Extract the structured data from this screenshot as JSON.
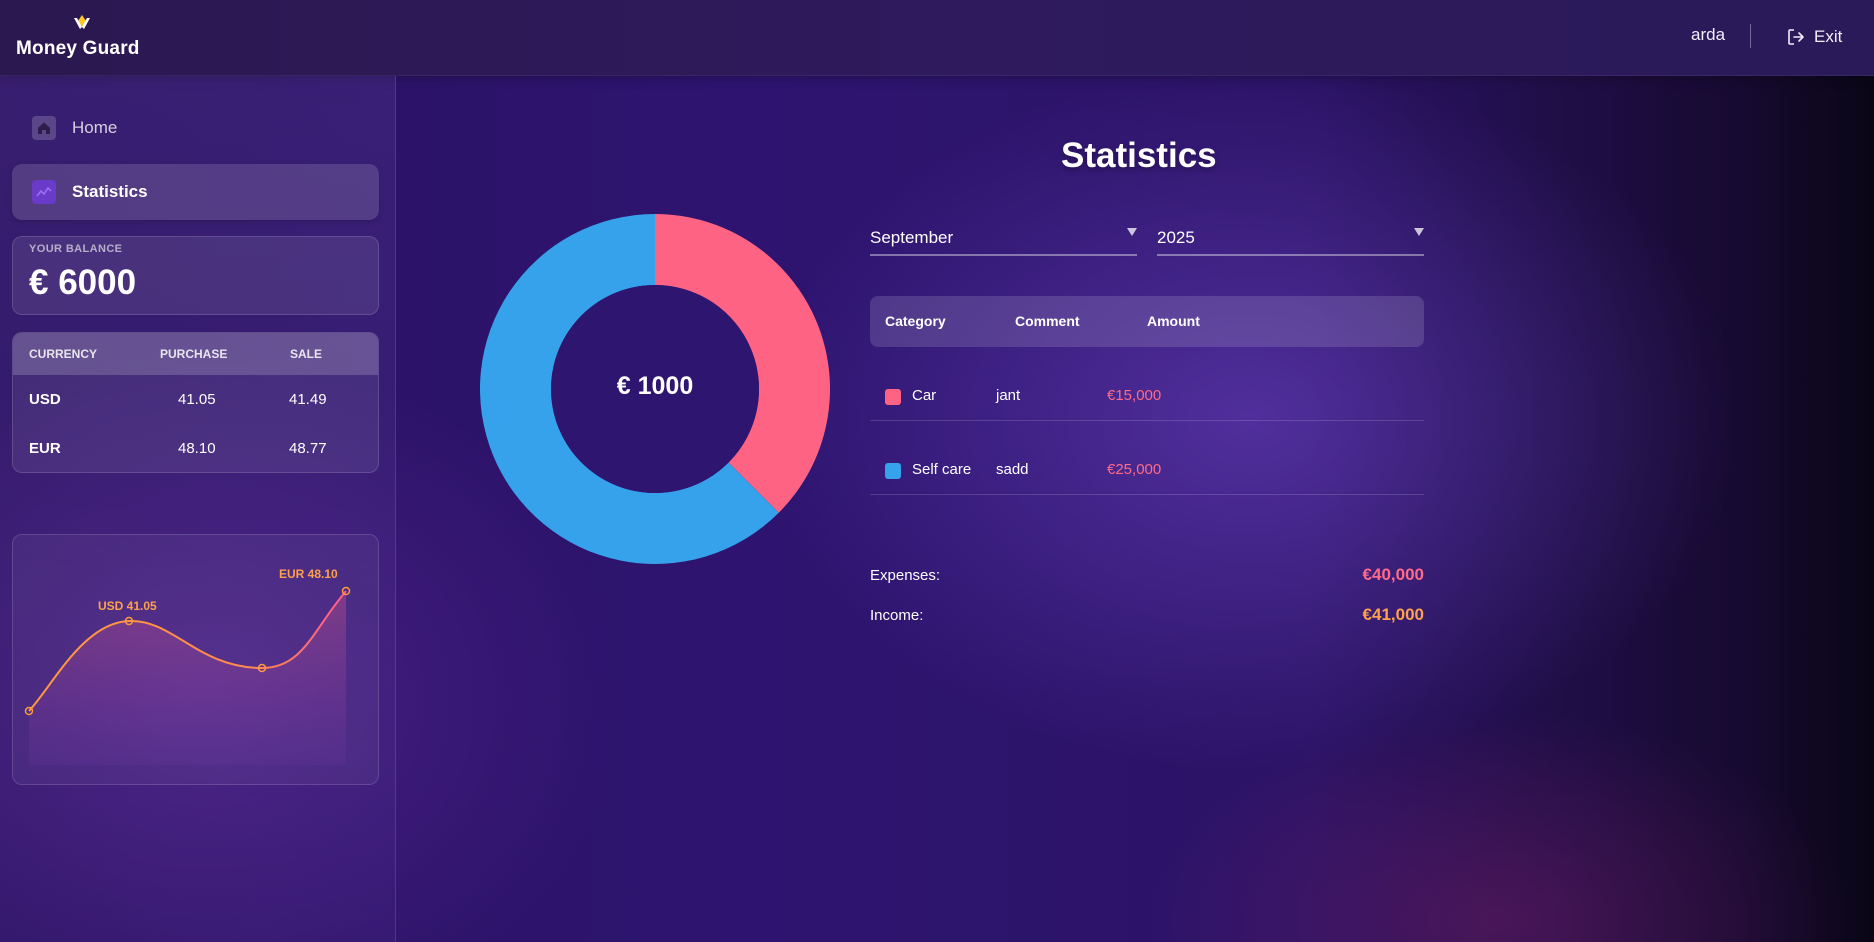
{
  "header": {
    "logo_text": "Money Guard",
    "username": "arda",
    "exit_label": "Exit"
  },
  "sidebar": {
    "items": [
      {
        "label": "Home",
        "icon": "home-icon",
        "active": false
      },
      {
        "label": "Statistics",
        "icon": "statistics-icon",
        "active": true
      }
    ],
    "balance": {
      "label": "YOUR BALANCE",
      "value": "€ 6000"
    },
    "currency": {
      "headers": [
        "CURRENCY",
        "PURCHASE",
        "SALE"
      ],
      "rows": [
        {
          "code": "USD",
          "purchase": "41.05",
          "sale": "41.49"
        },
        {
          "code": "EUR",
          "purchase": "48.10",
          "sale": "48.77"
        }
      ]
    },
    "mini_chart": {
      "labels": {
        "usd": "USD 41.05",
        "eur": "EUR 48.10"
      },
      "line_color": "#ff9a3c",
      "accent_color": "#ff6b88"
    }
  },
  "main": {
    "title": "Statistics",
    "donut_center": "€ 1000",
    "month": "September",
    "year": "2025",
    "table": {
      "headers": [
        "Category",
        "Comment",
        "Amount"
      ],
      "rows": [
        {
          "category": "Car",
          "comment": "jant",
          "amount": "€15,000",
          "color": "#ff6384"
        },
        {
          "category": "Self care",
          "comment": "sadd",
          "amount": "€25,000",
          "color": "#36a2eb"
        }
      ]
    },
    "totals": {
      "expenses_label": "Expenses:",
      "expenses_value": "€40,000",
      "income_label": "Income:",
      "income_value": "€41,000"
    }
  },
  "chart_data": {
    "type": "pie",
    "categories": [
      "Car",
      "Self care"
    ],
    "values": [
      15000,
      25000
    ],
    "colors": [
      "#ff6384",
      "#36a2eb"
    ],
    "center_label": "€ 1000"
  },
  "colors": {
    "expense": "#ff6b88",
    "income": "#ffa14a",
    "active_nav": "#6a3ac8"
  }
}
